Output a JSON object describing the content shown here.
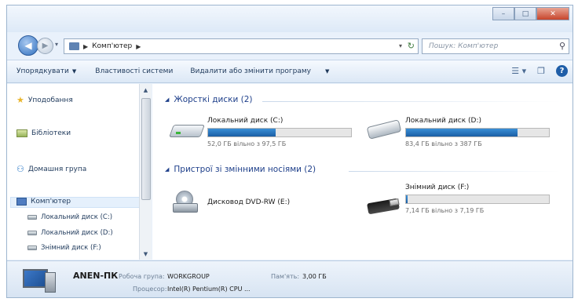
{
  "window": {
    "caption_buttons": {
      "minimize": "–",
      "maximize": "□",
      "close": "✕"
    }
  },
  "navigation": {
    "back_icon": "back-arrow-icon",
    "forward_icon": "forward-arrow-icon",
    "breadcrumb": [
      "Комп'ютер"
    ],
    "search_placeholder": "Пошук: Комп'ютер"
  },
  "toolbar": {
    "organize": "Упорядкувати",
    "system_properties": "Властивості системи",
    "uninstall": "Видалити або змінити програму"
  },
  "sidebar": {
    "items": [
      {
        "label": "Уподобання",
        "icon": "star-icon"
      },
      {
        "label": "Бібліотеки",
        "icon": "library-icon"
      },
      {
        "label": "Домашня група",
        "icon": "homegroup-icon"
      },
      {
        "label": "Комп'ютер",
        "icon": "computer-icon"
      },
      {
        "label": "Локальний диск (C:)",
        "icon": "disk-icon"
      },
      {
        "label": "Локальний диск (D:)",
        "icon": "disk-icon"
      },
      {
        "label": "Знімний диск (F:)",
        "icon": "removable-disk-icon"
      }
    ]
  },
  "groups": {
    "hard_disks": {
      "title": "Жорсткі диски (2)",
      "drives": [
        {
          "name": "Локальний диск (C:)",
          "free_text": "52,0 ГБ вільно з 97,5 ГБ",
          "used_fraction": 0.47
        },
        {
          "name": "Локальний диск (D:)",
          "free_text": "83,4 ГБ вільно з 387 ГБ",
          "used_fraction": 0.78
        }
      ]
    },
    "removable": {
      "title": "Пристрої зі змінними носіями (2)",
      "drives": [
        {
          "name": "Дисковод DVD-RW (E:)"
        },
        {
          "name": "Знімний диск (F:)",
          "free_text": "7,14 ГБ вільно з 7,19 ГБ",
          "used_fraction": 0.01
        }
      ]
    }
  },
  "details": {
    "computer_name": "ANEN-ПК",
    "workgroup_label": "Робоча група:",
    "workgroup_value": "WORKGROUP",
    "memory_label": "Пам'ять:",
    "memory_value": "3,00 ГБ",
    "processor_label": "Процесор:",
    "processor_value": "Intel(R) Pentium(R) CPU ..."
  },
  "colors": {
    "accent": "#1e3f8a",
    "bar_fill": "#2a77c4"
  }
}
